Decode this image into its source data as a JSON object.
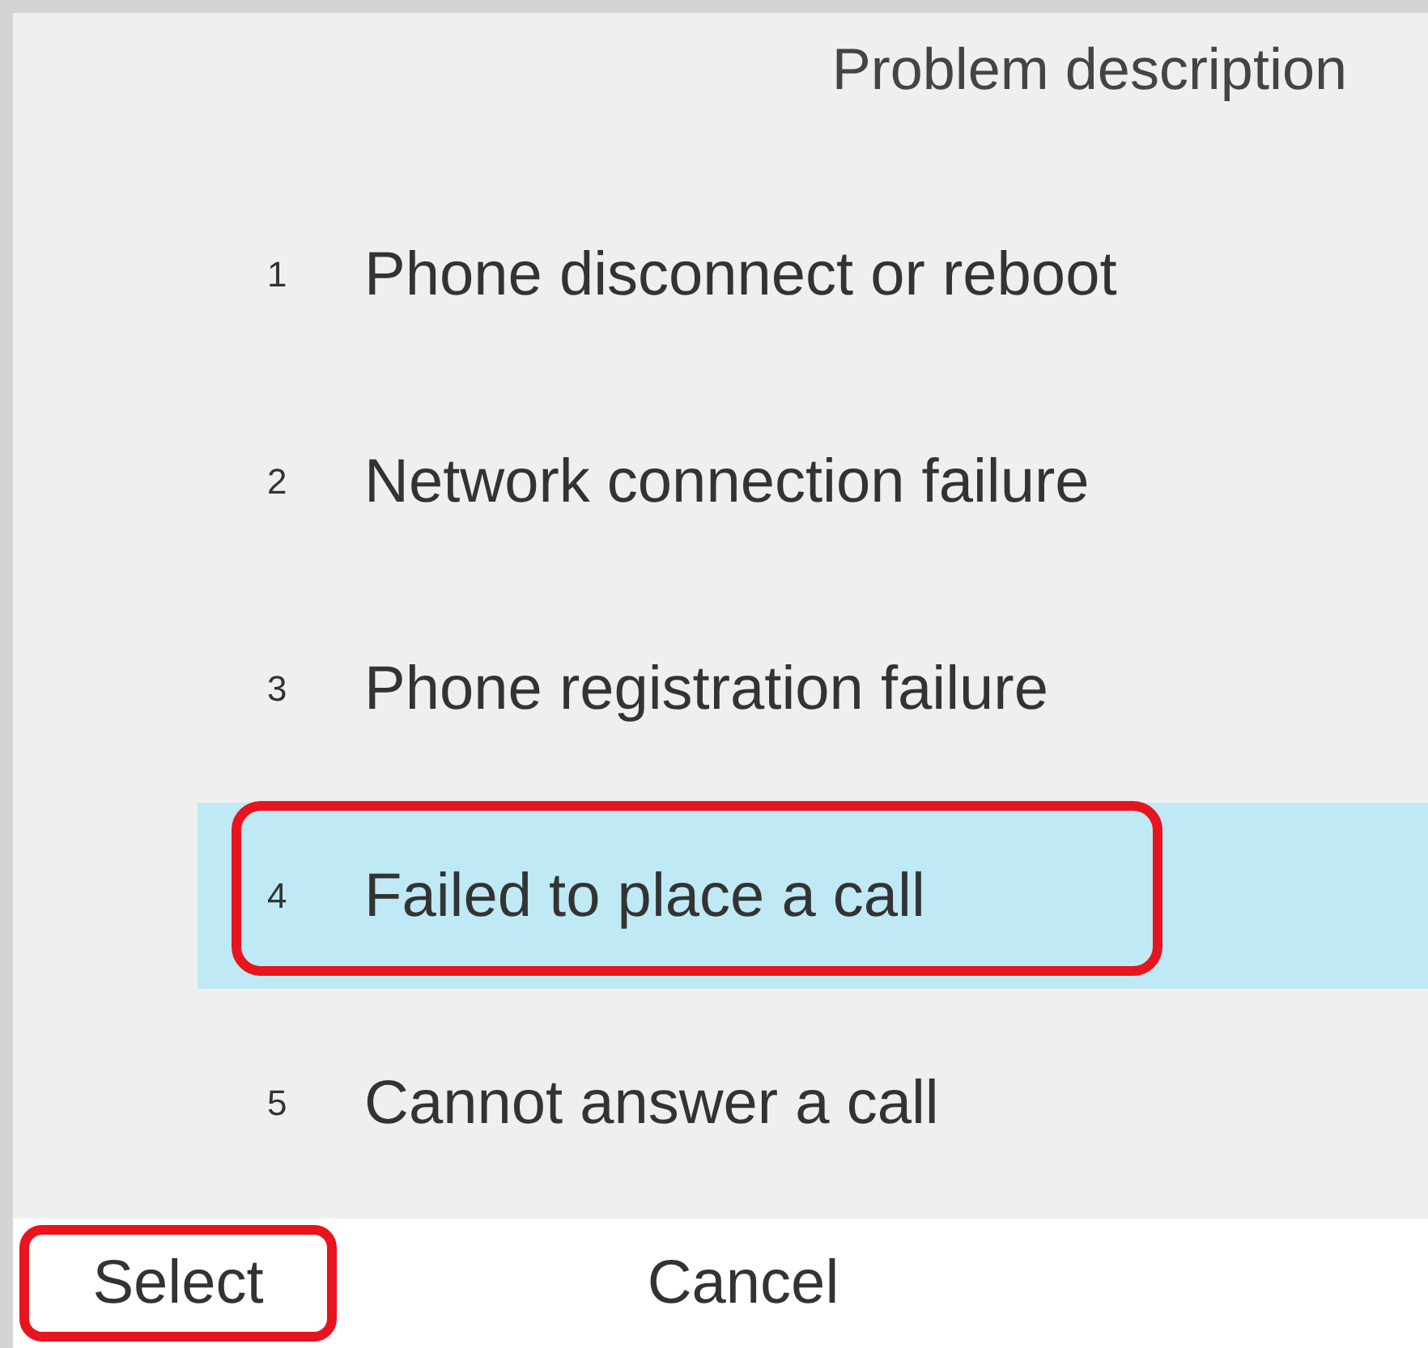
{
  "title": "Problem description",
  "items": [
    {
      "number": "1",
      "label": "Phone disconnect or reboot",
      "selected": false,
      "highlighted": false
    },
    {
      "number": "2",
      "label": "Network connection failure",
      "selected": false,
      "highlighted": false
    },
    {
      "number": "3",
      "label": "Phone registration failure",
      "selected": false,
      "highlighted": false
    },
    {
      "number": "4",
      "label": "Failed to place a call",
      "selected": true,
      "highlighted": true
    },
    {
      "number": "5",
      "label": "Cannot answer a call",
      "selected": false,
      "highlighted": false
    }
  ],
  "softkeys": [
    {
      "label": "Select",
      "highlighted": true
    },
    {
      "label": "Cancel",
      "highlighted": false
    }
  ]
}
